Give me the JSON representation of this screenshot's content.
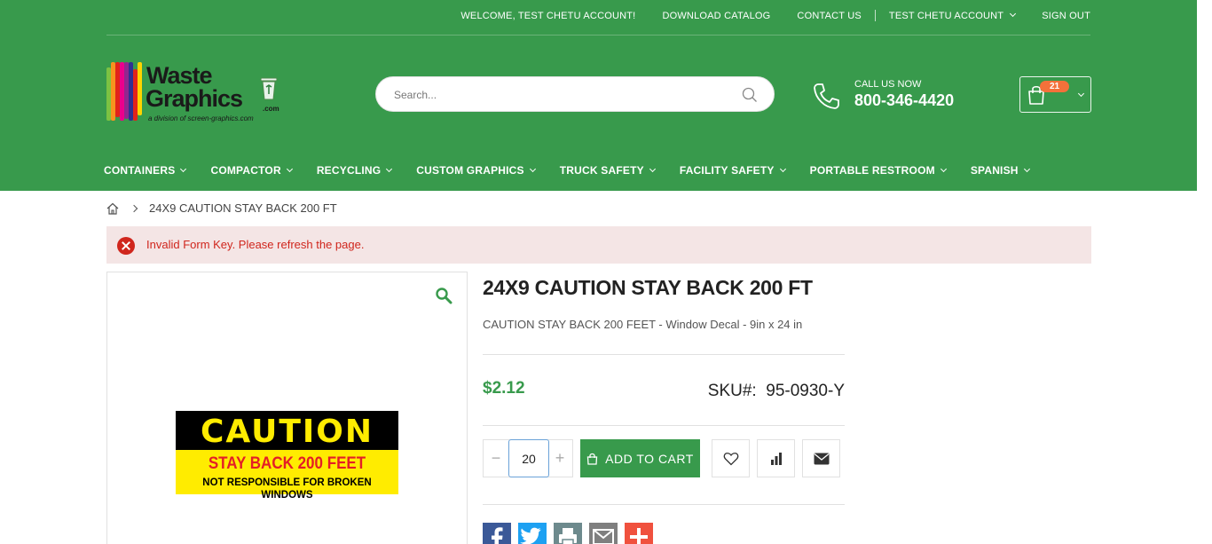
{
  "topbar": {
    "welcome": "WELCOME, TEST CHETU ACCOUNT!",
    "download_catalog": "DOWNLOAD CATALOG",
    "contact_us": "CONTACT US",
    "account": "TEST CHETU ACCOUNT",
    "sign_out": "SIGN OUT"
  },
  "logo": {
    "line1": "Waste",
    "line2": "Graphics",
    "suffix": ".com",
    "tagline": "a division of screen-graphics.com"
  },
  "search": {
    "placeholder": "Search..."
  },
  "call": {
    "label": "CALL US NOW",
    "number": "800-346-4420"
  },
  "cart": {
    "count": "21"
  },
  "nav": {
    "items": [
      "CONTAINERS",
      "COMPACTOR",
      "RECYCLING",
      "CUSTOM GRAPHICS",
      "TRUCK SAFETY",
      "FACILITY SAFETY",
      "PORTABLE RESTROOM",
      "SPANISH"
    ]
  },
  "breadcrumb": {
    "current": "24X9 CAUTION STAY BACK 200 FT"
  },
  "alert": {
    "message": "Invalid Form Key. Please refresh the page."
  },
  "decal": {
    "line1": "CAUTION",
    "line2": "STAY BACK 200 FEET",
    "line3": "NOT RESPONSIBLE FOR BROKEN WINDOWS"
  },
  "product": {
    "title": "24X9 CAUTION STAY BACK 200 FT",
    "description": "CAUTION STAY BACK 200 FEET - Window Decal - 9in x 24 in",
    "price": "$2.12",
    "sku_label": "SKU#:",
    "sku": "95-0930-Y",
    "qty": "20",
    "add_to_cart": "ADD TO CART"
  },
  "colors": {
    "brand_green": "#389a4c",
    "badge_orange": "#f4713a",
    "error_red": "#d0261d",
    "alert_bg": "#f4e5e5"
  }
}
